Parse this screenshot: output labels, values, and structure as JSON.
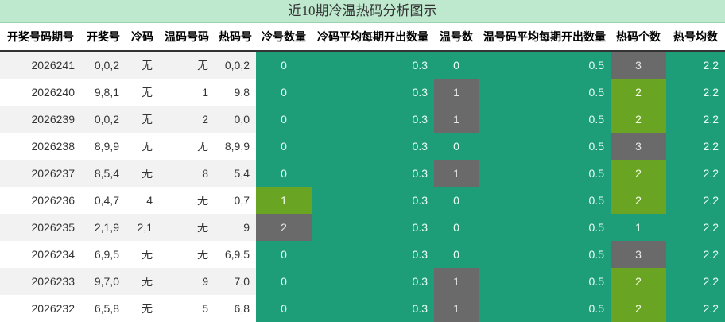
{
  "title": "近10期冷温热码分析图示",
  "headers": [
    "开奖号码期号",
    "开奖号",
    "冷码",
    "温码号码",
    "热码号",
    "冷号数量",
    "冷码平均每期开出数量",
    "温号数",
    "温号码平均每期开出数量",
    "热码个数",
    "热号均数"
  ],
  "colors": {
    "green": "#1e9e78",
    "dark": "#6a6a6a",
    "lime": "#69a522"
  },
  "rows": [
    {
      "period": "2026241",
      "draw": "0,0,2",
      "cold": "无",
      "warm": "无",
      "hot": "0,0,2",
      "cold_count": "0",
      "cold_avg": "0.3",
      "warm_count": "0",
      "warm_avg": "0.5",
      "hot_count": "3",
      "hot_avg": "2.2"
    },
    {
      "period": "2026240",
      "draw": "9,8,1",
      "cold": "无",
      "warm": "1",
      "hot": "9,8",
      "cold_count": "0",
      "cold_avg": "0.3",
      "warm_count": "1",
      "warm_avg": "0.5",
      "hot_count": "2",
      "hot_avg": "2.2"
    },
    {
      "period": "2026239",
      "draw": "0,0,2",
      "cold": "无",
      "warm": "2",
      "hot": "0,0",
      "cold_count": "0",
      "cold_avg": "0.3",
      "warm_count": "1",
      "warm_avg": "0.5",
      "hot_count": "2",
      "hot_avg": "2.2"
    },
    {
      "period": "2026238",
      "draw": "8,9,9",
      "cold": "无",
      "warm": "无",
      "hot": "8,9,9",
      "cold_count": "0",
      "cold_avg": "0.3",
      "warm_count": "0",
      "warm_avg": "0.5",
      "hot_count": "3",
      "hot_avg": "2.2"
    },
    {
      "period": "2026237",
      "draw": "8,5,4",
      "cold": "无",
      "warm": "8",
      "hot": "5,4",
      "cold_count": "0",
      "cold_avg": "0.3",
      "warm_count": "1",
      "warm_avg": "0.5",
      "hot_count": "2",
      "hot_avg": "2.2"
    },
    {
      "period": "2026236",
      "draw": "0,4,7",
      "cold": "4",
      "warm": "无",
      "hot": "0,7",
      "cold_count": "1",
      "cold_avg": "0.3",
      "warm_count": "0",
      "warm_avg": "0.5",
      "hot_count": "2",
      "hot_avg": "2.2"
    },
    {
      "period": "2026235",
      "draw": "2,1,9",
      "cold": "2,1",
      "warm": "无",
      "hot": "9",
      "cold_count": "2",
      "cold_avg": "0.3",
      "warm_count": "0",
      "warm_avg": "0.5",
      "hot_count": "1",
      "hot_avg": "2.2"
    },
    {
      "period": "2026234",
      "draw": "6,9,5",
      "cold": "无",
      "warm": "无",
      "hot": "6,9,5",
      "cold_count": "0",
      "cold_avg": "0.3",
      "warm_count": "0",
      "warm_avg": "0.5",
      "hot_count": "3",
      "hot_avg": "2.2"
    },
    {
      "period": "2026233",
      "draw": "9,7,0",
      "cold": "无",
      "warm": "9",
      "hot": "7,0",
      "cold_count": "0",
      "cold_avg": "0.3",
      "warm_count": "1",
      "warm_avg": "0.5",
      "hot_count": "2",
      "hot_avg": "2.2"
    },
    {
      "period": "2026232",
      "draw": "6,5,8",
      "cold": "无",
      "warm": "5",
      "hot": "6,8",
      "cold_count": "0",
      "cold_avg": "0.3",
      "warm_count": "1",
      "warm_avg": "0.5",
      "hot_count": "2",
      "hot_avg": "2.2"
    }
  ]
}
